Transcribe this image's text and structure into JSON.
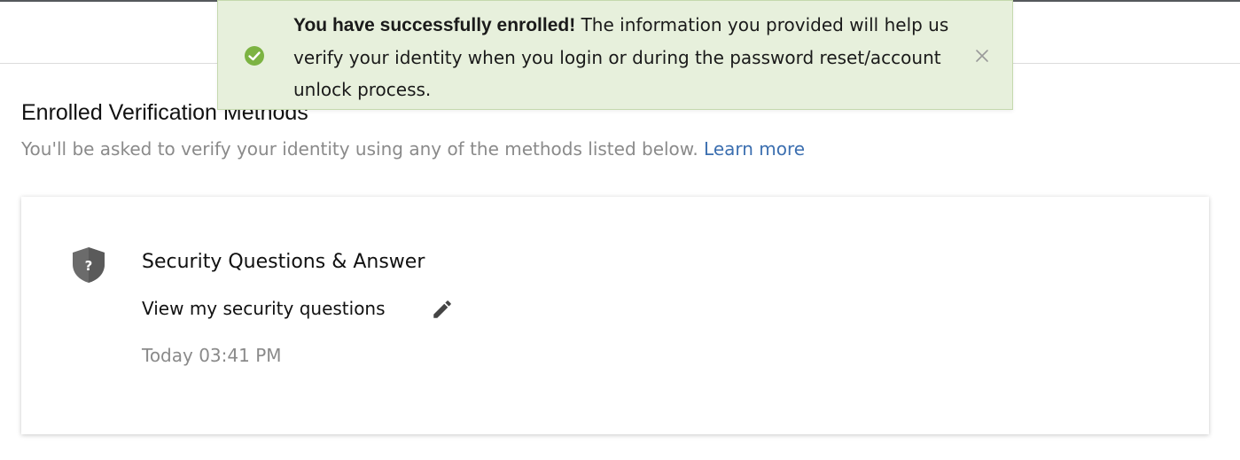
{
  "notification": {
    "title": "You have successfully enrolled!",
    "message": "The information you provided will help us verify your identity when you login or during the password reset/account unlock process.",
    "status_icon": "check-circle-icon",
    "close_icon": "close-icon"
  },
  "section": {
    "title": "Enrolled Verification Methods",
    "subtitle": "You'll be asked to verify your identity using any of the methods listed below.",
    "learn_more": "Learn more"
  },
  "method": {
    "icon": "shield-question-icon",
    "title": "Security Questions & Answer",
    "link": "View my security questions",
    "edit_icon": "pencil-icon",
    "timestamp": "Today 03:41 PM"
  },
  "colors": {
    "success_bg": "#e7f0dc",
    "success_icon": "#7cb342",
    "link": "#3c6fb0",
    "muted_text": "#8a8a8a"
  }
}
